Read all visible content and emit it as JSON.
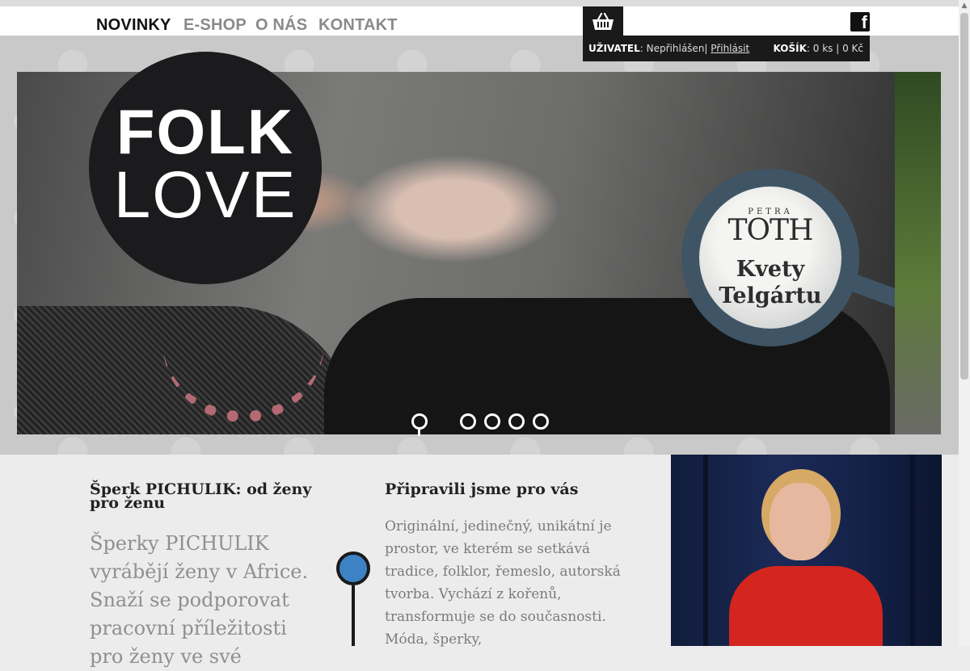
{
  "nav": {
    "items": [
      "NOVINKY",
      "E-SHOP",
      "O NÁS",
      "KONTAKT"
    ],
    "active": "NOVINKY"
  },
  "userbar": {
    "user_label": "UŽIVATEL",
    "user_status": "Nepřihlášen",
    "login_link": "Přihlásit",
    "cart_label": "KOŠÍK",
    "cart_count": "0 ks",
    "cart_total": "0 Kč"
  },
  "logo": {
    "line1": "FOLK",
    "line2": "LOVE"
  },
  "slider": {
    "badge_brand_small": "PETRA",
    "badge_brand": "TOTH",
    "badge_title_1": "Kvety",
    "badge_title_2": "Telgártu",
    "dots": 5,
    "active_dot": 0
  },
  "article1": {
    "title": "Šperk PICHULIK: od ženy pro ženu",
    "lead": "Šperky PICHULIK vyrábějí ženy v Africe. Snaží se podporovat pracovní příležitosti pro ženy ve své"
  },
  "article2": {
    "title": "Připravili jsme pro vás",
    "text": "Originální, jedinečný, unikátní je prostor, ve kterém se setkává tradice, folklor, řemeslo, autorská tvorba. Vychází z kořenů, transformuje se do současnosti. Móda, šperky,"
  },
  "colors": {
    "nav_active": "#111111",
    "nav_inactive": "#8a8a8a",
    "dark_bar": "#1a1a1a",
    "pin_blue": "#3d82c4",
    "badge_ring": "#3f5565"
  }
}
